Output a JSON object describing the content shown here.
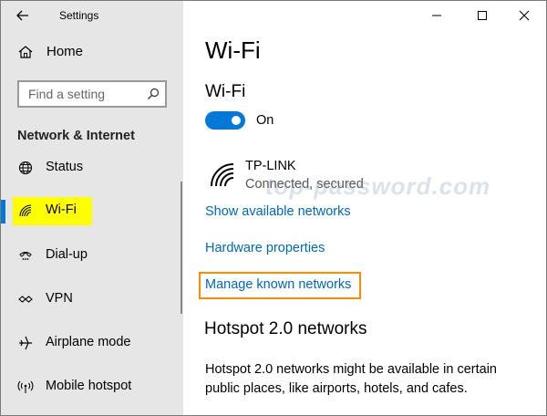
{
  "window": {
    "title": "Settings"
  },
  "sidebar": {
    "home_label": "Home",
    "search_placeholder": "Find a setting",
    "section_heading": "Network & Internet",
    "items": [
      {
        "label": "Status",
        "icon": "globe-icon"
      },
      {
        "label": "Wi-Fi",
        "icon": "wifi-icon",
        "selected": true
      },
      {
        "label": "Dial-up",
        "icon": "phone-icon"
      },
      {
        "label": "VPN",
        "icon": "vpn-icon"
      },
      {
        "label": "Airplane mode",
        "icon": "airplane-icon"
      },
      {
        "label": "Mobile hotspot",
        "icon": "hotspot-icon"
      }
    ]
  },
  "main": {
    "page_title": "Wi-Fi",
    "wifi_heading": "Wi-Fi",
    "toggle_label": "On",
    "toggle_on": true,
    "network": {
      "name": "TP-LINK",
      "status": "Connected, secured"
    },
    "watermark": "top-password.com",
    "links": {
      "show_networks": "Show available networks",
      "hardware_properties": "Hardware properties",
      "manage_known": "Manage known networks"
    },
    "hotspot_heading": "Hotspot 2.0 networks",
    "hotspot_description": "Hotspot 2.0 networks might be available in certain public places, like airports, hotels, and cafes."
  },
  "colors": {
    "accent": "#0078d7",
    "link": "#0067b8",
    "highlight": "#ffff00",
    "callout": "#ff8c00",
    "sidebar_bg": "#e6e6e6"
  }
}
